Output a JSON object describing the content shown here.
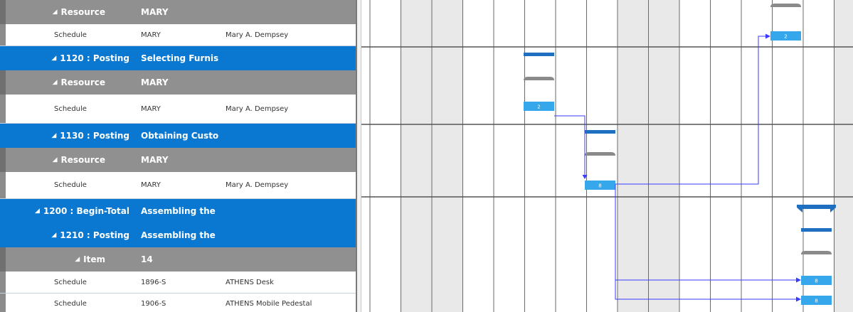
{
  "grid": {
    "rows": [
      {
        "type": "group",
        "col1": "Resource",
        "col2": "MARY",
        "col3": ""
      },
      {
        "type": "detail",
        "col1": "Schedule",
        "col2": "MARY",
        "col3": "Mary A. Dempsey"
      },
      {
        "type": "posting",
        "col1": "1120 : Posting",
        "col2": "Selecting Furnishings",
        "col3": ""
      },
      {
        "type": "group",
        "col1": "Resource",
        "col2": "MARY",
        "col3": ""
      },
      {
        "type": "detail",
        "col1": "Schedule",
        "col2": "MARY",
        "col3": "Mary A. Dempsey"
      },
      {
        "type": "posting",
        "col1": "1130 : Posting",
        "col2": "Obtaining Customer Approval",
        "col3": ""
      },
      {
        "type": "group",
        "col1": "Resource",
        "col2": "MARY",
        "col3": ""
      },
      {
        "type": "detail",
        "col1": "Schedule",
        "col2": "MARY",
        "col3": "Mary A. Dempsey"
      },
      {
        "type": "posting",
        "col1": "1200 : Begin-Total",
        "col2": "Assembling the Furniture etc.",
        "col3": ""
      },
      {
        "type": "posting",
        "col1": "1210 : Posting",
        "col2": "Assembling the Furniture etc.",
        "col3": ""
      },
      {
        "type": "group",
        "col1": "Item",
        "col2": "14",
        "col3": ""
      },
      {
        "type": "detail",
        "col1": "Schedule",
        "col2": "1896-S",
        "col3": "ATHENS Desk"
      },
      {
        "type": "detail",
        "col1": "Schedule",
        "col2": "1906-S",
        "col3": "ATHENS Mobile Pedestal"
      }
    ]
  },
  "gantt": {
    "colors": {
      "shaded_column": "#e9e9e9",
      "grid_line": "#555555",
      "summary_bar": "#1f6fc0",
      "resource_bar": "#8a8a8a",
      "capacity_bar": "#35a7ea",
      "link": "#3a3aff"
    },
    "capacity_labels": [
      "2",
      "2",
      "8",
      "8",
      "8"
    ]
  }
}
